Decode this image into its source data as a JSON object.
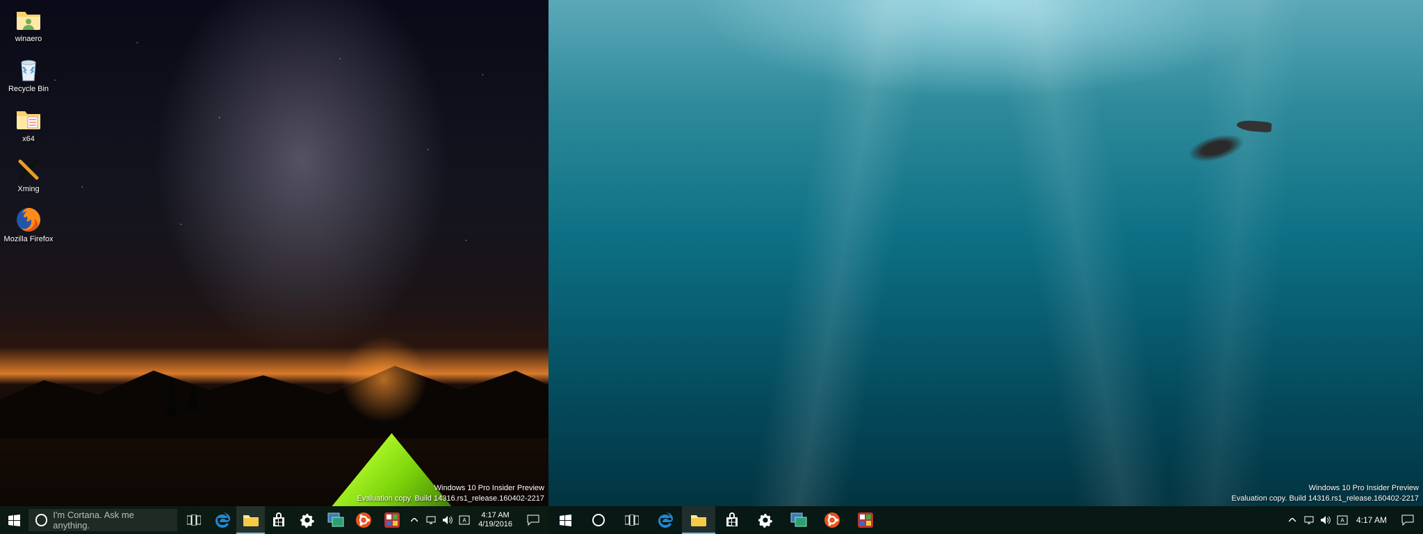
{
  "left": {
    "desktop_icons": [
      {
        "id": "winaero",
        "label": "winaero",
        "kind": "folder-user"
      },
      {
        "id": "recycle",
        "label": "Recycle Bin",
        "kind": "recycle-bin"
      },
      {
        "id": "x64",
        "label": "x64",
        "kind": "folder"
      },
      {
        "id": "xming",
        "label": "Xming",
        "kind": "xming"
      },
      {
        "id": "firefox",
        "label": "Mozilla Firefox",
        "kind": "firefox"
      }
    ],
    "watermark": {
      "line1": "Windows 10 Pro Insider Preview",
      "line2": "Evaluation copy. Build 14316.rs1_release.160402-2217"
    },
    "cortana_placeholder": "I'm Cortana. Ask me anything.",
    "taskbar": {
      "apps": [
        {
          "id": "task-view",
          "kind": "taskview"
        },
        {
          "id": "edge",
          "kind": "edge"
        },
        {
          "id": "explorer",
          "kind": "explorer",
          "active": true,
          "opened": true
        },
        {
          "id": "store",
          "kind": "store"
        },
        {
          "id": "settings",
          "kind": "settings"
        },
        {
          "id": "hyperv",
          "kind": "hyperv"
        },
        {
          "id": "ubuntu",
          "kind": "ubuntu"
        },
        {
          "id": "gpick",
          "kind": "gpick"
        }
      ],
      "tray_icons": [
        "chevron-up",
        "network",
        "volume",
        "ime"
      ],
      "time": "4:17 AM",
      "date": "4/19/2016"
    }
  },
  "right": {
    "watermark": {
      "line1": "Windows 10 Pro Insider Preview",
      "line2": "Evaluation copy. Build 14316.rs1_release.160402-2217"
    },
    "taskbar": {
      "apps": [
        {
          "id": "task-view",
          "kind": "taskview"
        },
        {
          "id": "edge",
          "kind": "edge"
        },
        {
          "id": "explorer",
          "kind": "explorer",
          "active": true,
          "opened": true
        },
        {
          "id": "store",
          "kind": "store"
        },
        {
          "id": "settings",
          "kind": "settings"
        },
        {
          "id": "hyperv",
          "kind": "hyperv"
        },
        {
          "id": "ubuntu",
          "kind": "ubuntu"
        },
        {
          "id": "gpick",
          "kind": "gpick"
        }
      ],
      "tray_icons": [
        "chevron-up",
        "network",
        "volume",
        "ime"
      ],
      "time": "4:17 AM"
    }
  }
}
